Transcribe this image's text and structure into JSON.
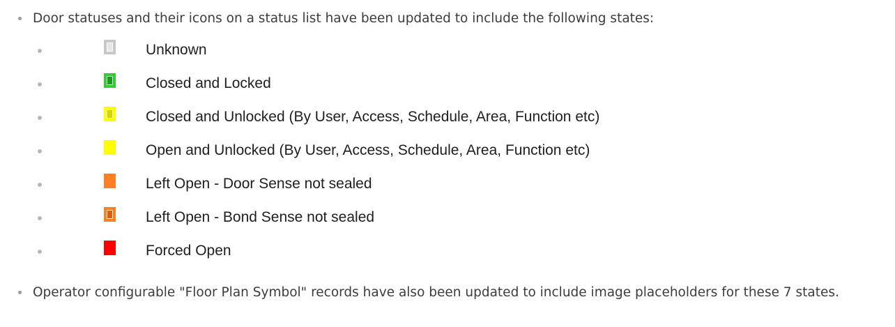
{
  "intro": "Door statuses and their icons on a status list have been updated to include the following states:",
  "statuses": [
    {
      "label": "Unknown",
      "icon": "door-unknown-icon",
      "style": "outlined",
      "color": "#c8c8c8",
      "inner": "#e6e6e6"
    },
    {
      "label": "Closed and Locked",
      "icon": "door-closed-locked-icon",
      "style": "outlined",
      "color": "#33cc33",
      "inner": "#1a9e1a"
    },
    {
      "label": "Closed and Unlocked (By User, Access, Schedule, Area, Function etc)",
      "icon": "door-closed-unlocked-icon",
      "style": "outlined",
      "color": "#ffff00",
      "inner": "#d4d400"
    },
    {
      "label": "Open and Unlocked (By User, Access, Schedule, Area, Function etc)",
      "icon": "door-open-unlocked-icon",
      "style": "solid",
      "color": "#ffff00"
    },
    {
      "label": "Left Open - Door Sense not sealed",
      "icon": "door-left-open-door-sense-icon",
      "style": "solid",
      "color": "#ff7f27"
    },
    {
      "label": "Left Open - Bond Sense not sealed",
      "icon": "door-left-open-bond-sense-icon",
      "style": "outlined",
      "color": "#ff7f27",
      "inner": "#d85f10"
    },
    {
      "label": "Forced Open",
      "icon": "door-forced-open-icon",
      "style": "solid",
      "color": "#ff0000"
    }
  ],
  "outro": "Operator configurable \"Floor Plan Symbol\" records have also been updated to include image placeholders for these 7 states."
}
